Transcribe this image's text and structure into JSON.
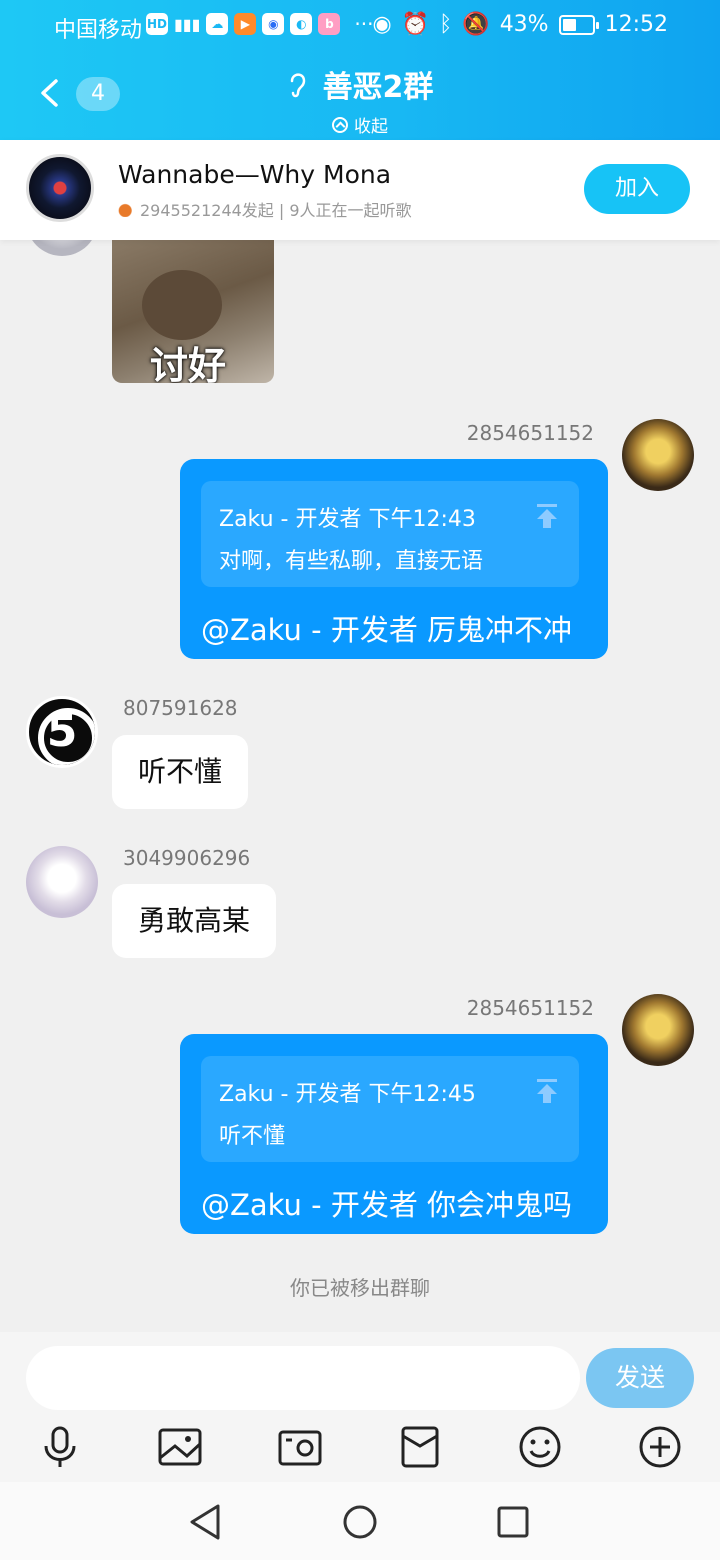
{
  "status_bar": {
    "carrier": "中国移动",
    "hd": "HD",
    "battery": "43%",
    "time": "12:52"
  },
  "header": {
    "back_count": "4",
    "title": "善恶2群",
    "collapse_label": "收起"
  },
  "music": {
    "title": "Wannabe—Why Mona",
    "subtitle": "2945521244发起 | 9人正在一起听歌",
    "join_label": "加入"
  },
  "messages": {
    "sticker_text": "讨好",
    "m1": {
      "sender": "2854651152",
      "quote_head": "Zaku - 开发者 下午12:43",
      "quote_body": "对啊，有些私聊，直接无语",
      "text": "@Zaku - 开发者 厉鬼冲不冲"
    },
    "m2": {
      "sender": "807591628",
      "text": "听不懂"
    },
    "m3": {
      "sender": "3049906296",
      "text": "勇敢高某"
    },
    "m4": {
      "sender": "2854651152",
      "quote_head": "Zaku - 开发者 下午12:45",
      "quote_body": "听不懂",
      "text": "@Zaku - 开发者 你会冲鬼吗"
    },
    "system_note": "你已被移出群聊"
  },
  "input": {
    "value": "",
    "send_label": "发送",
    "tools": [
      "microphone-icon",
      "image-icon",
      "camera-icon",
      "red-packet-icon",
      "emoji-icon",
      "plus-icon"
    ]
  },
  "nav": [
    "back-triangle-icon",
    "home-circle-icon",
    "recent-square-icon"
  ],
  "colors": {
    "header_gradient_start": "#1ec8f5",
    "header_gradient_end": "#0fa3f0",
    "my_bubble": "#0a99ff",
    "quote_bg": "#2aa8ff",
    "join_button": "#17c3f6",
    "send_button": "#7bc6f2",
    "chat_bg": "#f0f0f0"
  }
}
